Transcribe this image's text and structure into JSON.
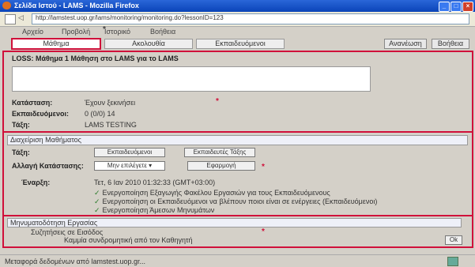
{
  "window": {
    "title": "Σελίδα Ιστού - LAMS - Mozilla Firefox"
  },
  "address": {
    "url": "http://lamstest.uop.gr/lams/monitoring/monitoring.do?lessonID=123"
  },
  "menu": {
    "items": [
      "Αρχείο",
      "Προβολή",
      "Ιστορικό",
      "Βοήθεια"
    ]
  },
  "tabs": {
    "items": [
      "Μάθημα",
      "Ακολουθία",
      "Εκπαιδευόμενοι"
    ],
    "active_index": 0
  },
  "toolbar_right": {
    "refresh_label": "Ανανέωση",
    "help_label": "Βοήθεια"
  },
  "lesson": {
    "title": "LOSS: Μάθημα 1 Μάθηση στο LAMS για το LAMS",
    "fields": [
      {
        "label": "Κατάσταση:",
        "value": "Έχουν ξεκινήσει"
      },
      {
        "label": "Εκπαιδευόμενοι:",
        "value": "0 (0/0) 14"
      },
      {
        "label": "Τάξη:",
        "value": "LAMS TESTING"
      }
    ]
  },
  "manage": {
    "header": "Διαχείριση Μαθήματος",
    "class_label": "Τάξη:",
    "class_buttons": [
      "Εκπαιδευόμενοι",
      "Εκπαιδευτές Τάξης"
    ],
    "status_label": "Αλλαγή Κατάστασης:",
    "status_select": "Μην επιλέγετε",
    "status_apply": "Εφαρμογή",
    "schedule_label": "Έναρξη:",
    "schedule_value": "Τετ, 6 Ιαν 2010 01:32:33 (GMT+03:00)",
    "options": [
      "Ενεργοποίηση Εξαγωγής Φακέλου Εργασιών για τους Εκπαιδευόμενους",
      "Ενεργοποίηση οι Εκπαιδευόμενοι να βλέπουν ποιοι είναι σε ενέργειες (Εκπαιδευόμενοι)",
      "Ενεργοποίηση Άμεσων Μηνυμάτων"
    ]
  },
  "chat": {
    "header": "Μηνυματοδότηση Εργασίας",
    "row1": "Συζητήσεις σε Εισόδος",
    "row2": "Καμμία συνδρομητική από τον Καθηγητή",
    "go_label": "Ok"
  },
  "status": {
    "text": "Μεταφορά δεδομένων από lamstest.uop.gr..."
  }
}
